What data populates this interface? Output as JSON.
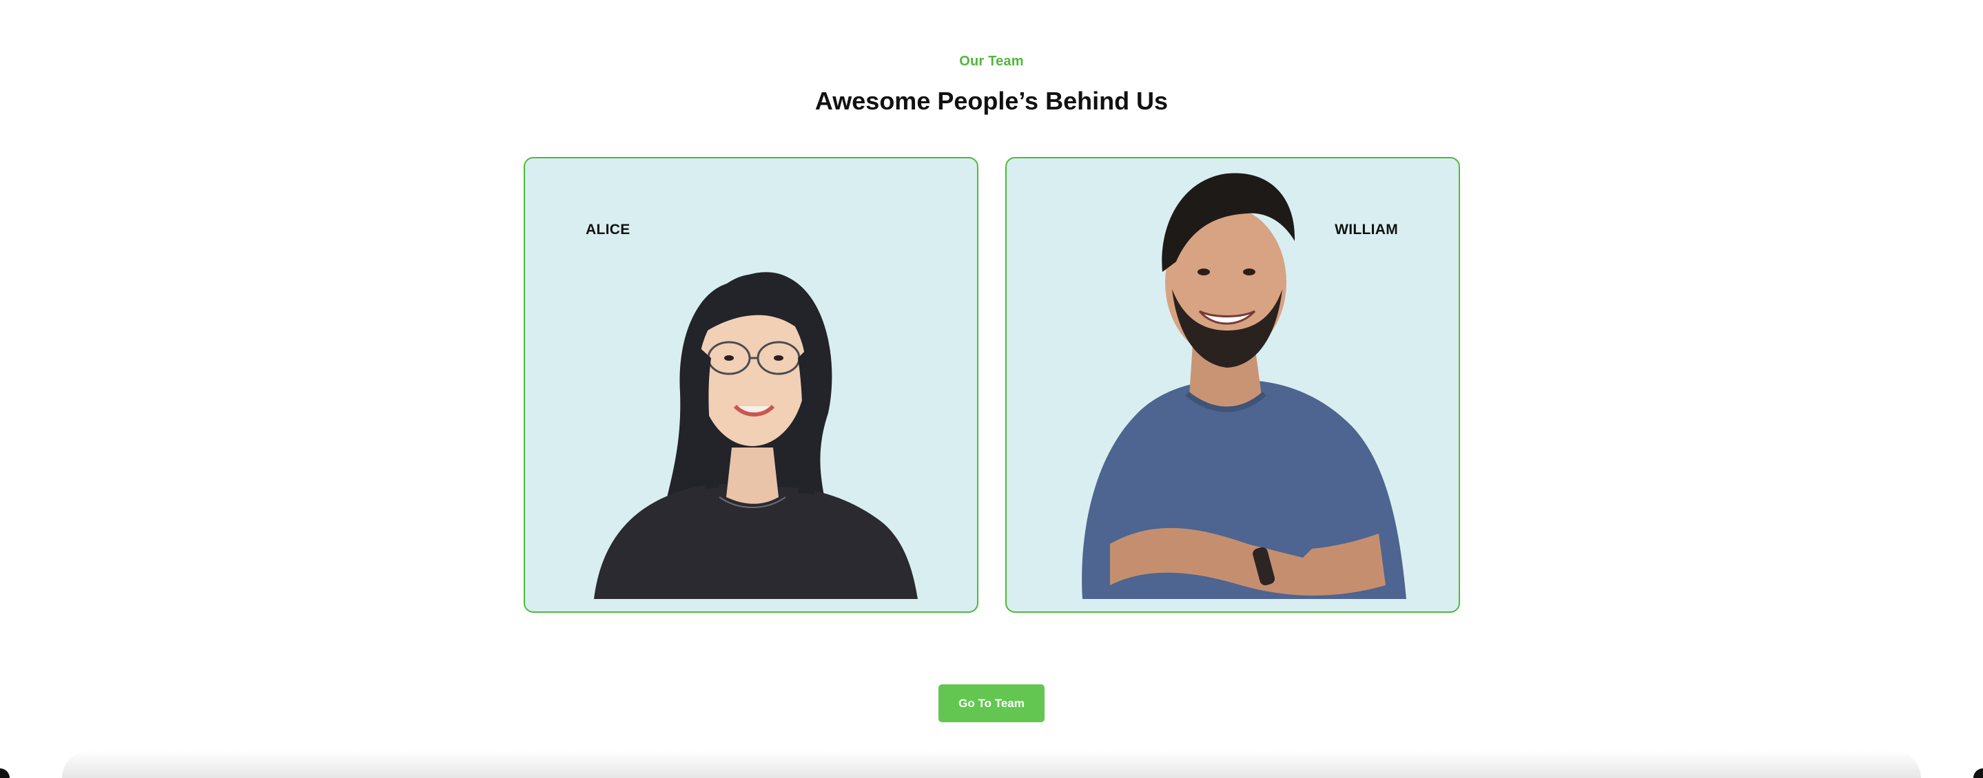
{
  "section": {
    "eyebrow": "Our Team",
    "heading": "Awesome People’s Behind Us"
  },
  "team": [
    {
      "name": "ALICE"
    },
    {
      "name": "WILLIAM"
    }
  ],
  "cta": {
    "label": "Go To Team"
  },
  "colors": {
    "accent": "#52b63c",
    "button": "#63c651",
    "card_bg": "#d9eef0",
    "card_border": "#4cbb3a"
  }
}
